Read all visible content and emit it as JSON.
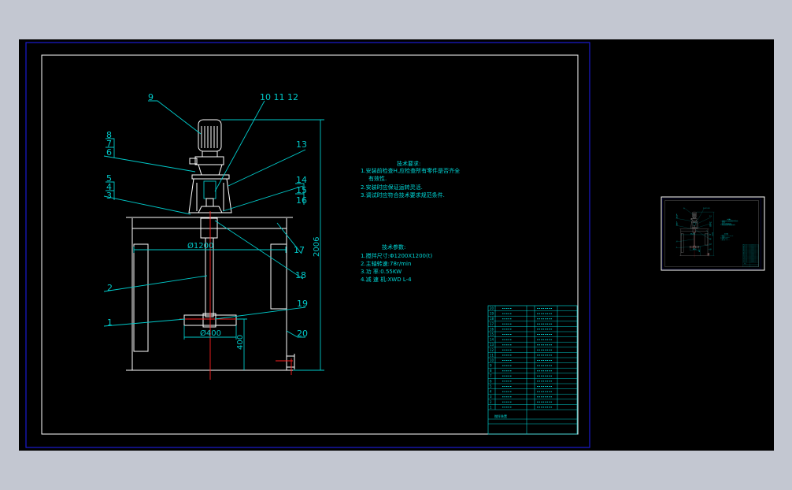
{
  "colors": {
    "background": "#c3c7d1",
    "canvas": "#000000",
    "frame": "#ffffff",
    "sheet_border": "#1a1ad0",
    "annotation": "#00c8c8",
    "centerline": "#ff2020"
  },
  "drawing": {
    "labels": {
      "p9": "9",
      "p10_12": "10 11 12",
      "p8": "8",
      "p7": "7",
      "p6": "6",
      "p5": "5",
      "p4": "4",
      "p3": "3",
      "p13": "13",
      "p14": "14",
      "p15": "15",
      "p16": "16",
      "p17": "17",
      "p18": "18",
      "p2": "2",
      "p19": "19",
      "p1": "1",
      "p20": "20"
    },
    "dimensions": {
      "tank_dia": "Ø1200",
      "impeller_dia": "Ø400",
      "impeller_height": "400",
      "total_height": "2006"
    }
  },
  "notes": {
    "requirements_title": "技术要求:",
    "requirements": [
      "1.安装前检查H,应检查所有零件是否齐全",
      "有效性.",
      "2.安装时应保证运转灵活.",
      "3.调试时应符合技术要求规范条件."
    ],
    "params_title": "技术参数:",
    "params": [
      "1.搅拌尺寸:Φ1200X1200(t)",
      "2.主轴转速:78r/min",
      "3.功    率:0.55KW",
      "4.减 速 机:XWD L-4"
    ]
  },
  "parts_table": {
    "item_numbers": [
      "20",
      "19",
      "18",
      "17",
      "16",
      "15",
      "14",
      "13",
      "12",
      "11",
      "10",
      "9",
      "8",
      "7",
      "6",
      "5",
      "4",
      "3",
      "2",
      "1"
    ],
    "title": "搅拌装置"
  }
}
